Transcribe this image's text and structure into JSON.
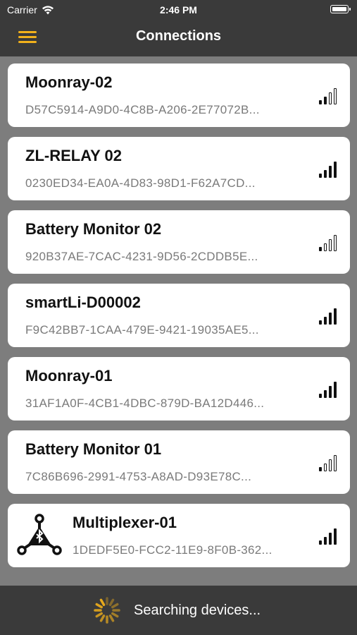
{
  "status_bar": {
    "carrier": "Carrier",
    "time": "2:46 PM"
  },
  "navbar": {
    "title": "Connections",
    "accent_color": "#f2b11b"
  },
  "devices": [
    {
      "name": "Moonray-02",
      "uuid": "D57C5914-A9D0-4C8B-A206-2E77072B...",
      "signal": 2,
      "icon": null
    },
    {
      "name": "ZL-RELAY 02",
      "uuid": "0230ED34-EA0A-4D83-98D1-F62A7CD...",
      "signal": 4,
      "icon": null
    },
    {
      "name": "Battery Monitor 02",
      "uuid": "920B37AE-7CAC-4231-9D56-2CDDB5E...",
      "signal": 1,
      "icon": null
    },
    {
      "name": "smartLi-D00002",
      "uuid": "F9C42BB7-1CAA-479E-9421-19035AE5...",
      "signal": 4,
      "icon": null
    },
    {
      "name": "Moonray-01",
      "uuid": "31AF1A0F-4CB1-4DBC-879D-BA12D446...",
      "signal": 4,
      "icon": null
    },
    {
      "name": "Battery Monitor 01",
      "uuid": "7C86B696-2991-4753-A8AD-D93E78C...",
      "signal": 1,
      "icon": null
    },
    {
      "name": "Multiplexer-01",
      "uuid": "1DEDF5E0-FCC2-11E9-8F0B-362...",
      "signal": 4,
      "icon": "bluetooth-multiplexer-icon"
    }
  ],
  "bottom_bar": {
    "status_text": "Searching devices..."
  }
}
